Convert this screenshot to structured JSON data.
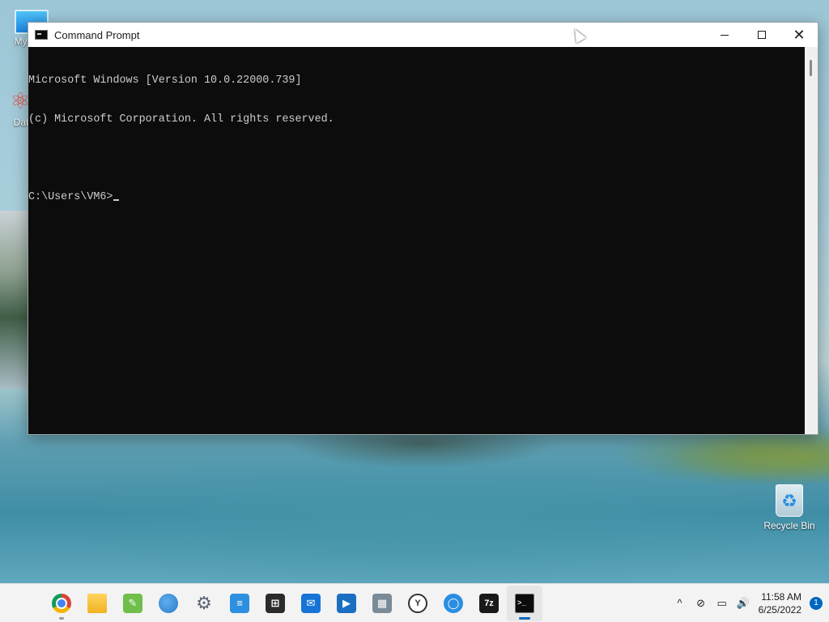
{
  "window": {
    "title": "Command Prompt",
    "minimize_glyph": "",
    "close_glyph": "✕"
  },
  "console": {
    "lines": [
      "Microsoft Windows [Version 10.0.22000.739]",
      "(c) Microsoft Corporation. All rights reserved.",
      "",
      "C:\\Users\\VM6>"
    ]
  },
  "desktop": {
    "icons": [
      {
        "name": "My Computer",
        "label": "My Co",
        "icon": "computer-icon"
      },
      {
        "name": "DataWrangler",
        "label": "DataW",
        "icon": "atom-shortcut-icon"
      },
      {
        "name": "Recycle Bin",
        "label": "Recycle Bin",
        "icon": "recycle-bin-icon"
      }
    ]
  },
  "taskbar": {
    "apps": [
      {
        "id": "start",
        "icon": "windows-start-icon",
        "glyph": ""
      },
      {
        "id": "chrome",
        "icon": "chrome-icon",
        "glyph": ""
      },
      {
        "id": "file-explorer",
        "icon": "folder-icon",
        "glyph": ""
      },
      {
        "id": "sticky",
        "icon": "notes-pen-icon",
        "glyph": "✎"
      },
      {
        "id": "maps",
        "icon": "globe-icon",
        "glyph": ""
      },
      {
        "id": "settings",
        "icon": "gear-icon",
        "glyph": "⚙"
      },
      {
        "id": "notepad",
        "icon": "notepad-icon",
        "glyph": "≡"
      },
      {
        "id": "store",
        "icon": "store-bag-icon",
        "glyph": "⊞"
      },
      {
        "id": "mail",
        "icon": "mail-icon",
        "glyph": "✉"
      },
      {
        "id": "video",
        "icon": "video-play-icon",
        "glyph": "▶"
      },
      {
        "id": "calculator",
        "icon": "calculator-icon",
        "glyph": "▦"
      },
      {
        "id": "clock",
        "icon": "clock-icon",
        "glyph": "Y"
      },
      {
        "id": "tips",
        "icon": "lightbulb-icon",
        "glyph": "◯"
      },
      {
        "id": "7zip",
        "icon": "7zip-icon",
        "glyph": "7z"
      },
      {
        "id": "cmd",
        "icon": "terminal-icon",
        "glyph": ">_"
      }
    ],
    "tray": {
      "chevron_glyph": "^",
      "network_glyph": "⊘",
      "display_glyph": "▭",
      "volume_glyph": "🔊",
      "time": "11:58 AM",
      "date": "6/25/2022",
      "notification_count": "1"
    }
  },
  "colors": {
    "accent": "#0067c0",
    "console_bg": "#0c0c0c",
    "console_fg": "#cccccc"
  }
}
